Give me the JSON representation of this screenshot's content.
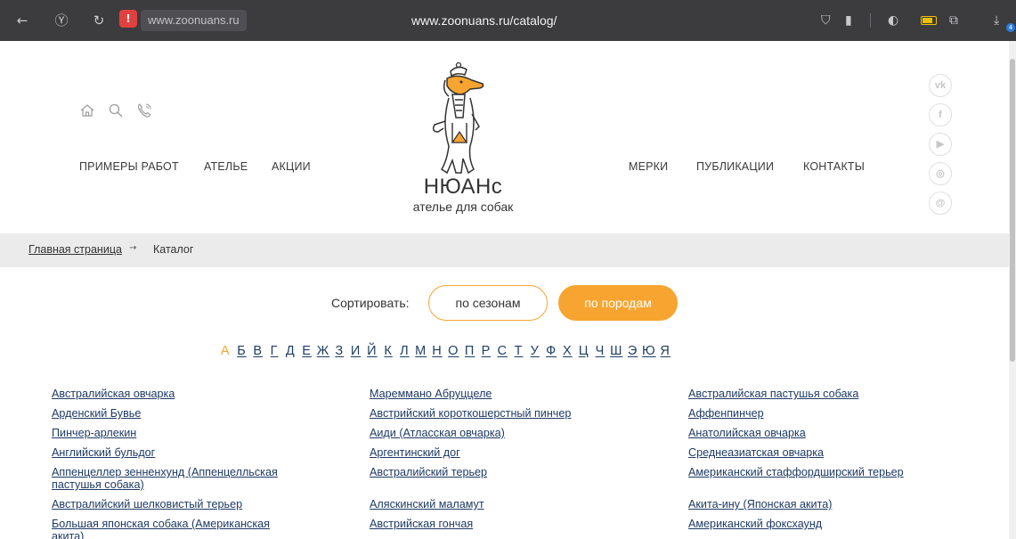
{
  "browser": {
    "site_chip": "www.zoonuans.ru",
    "url": "www.zoonuans.ru/catalog/",
    "badge": "!",
    "download_count": "4"
  },
  "nav": {
    "left": [
      "ПРИМЕРЫ РАБОТ",
      "АТЕЛЬЕ",
      "АКЦИИ"
    ],
    "right": [
      "МЕРКИ",
      "ПУБЛИКАЦИИ",
      "КОНТАКТЫ"
    ]
  },
  "logo": {
    "name": "НЮАНс",
    "subtitle": "ателье для собак"
  },
  "social": [
    "vk",
    "f",
    "▶",
    "◎",
    "@"
  ],
  "breadcrumb": {
    "home": "Главная страница",
    "arrow": "→",
    "current": "Каталог"
  },
  "sort": {
    "label": "Сортировать:",
    "by_season": "по сезонам",
    "by_breed": "по породам"
  },
  "alphabet": [
    "А",
    "Б",
    "В",
    "Г",
    "Д",
    "Е",
    "Ж",
    "З",
    "И",
    "Й",
    "К",
    "Л",
    "М",
    "Н",
    "О",
    "П",
    "Р",
    "С",
    "Т",
    "У",
    "Ф",
    "Х",
    "Ц",
    "Ч",
    "Ш",
    "Э",
    "Ю",
    "Я"
  ],
  "active_letter": "А",
  "breeds": {
    "col1": [
      "Австралийская овчарка",
      "Арденский Бувье",
      "Пинчер-арлекин",
      "Английский бульдог",
      "Аппенцеллер зенненхунд (Аппенцелльская",
      "пастушья собака)",
      "Австралийский шелковистый терьер",
      "Большая японская собака (Американская",
      "акита)"
    ],
    "col2": [
      "Мареммано Абруццеле",
      "Австрийский короткошерстный пинчер",
      "Аиди (Атласская овчарка)",
      "Аргентинский дог",
      "Австралийский терьер",
      "Аляскинский маламут",
      "Австрийская гончая"
    ],
    "col3": [
      "Австралийская пастушья собака",
      "Аффенпинчер",
      "Анатолийская овчарка",
      "Среднеазиатская овчарка",
      "Американский стаффордширский терьер",
      "Акита-ину (Японская акита)",
      "Американский фоксхаунд"
    ]
  },
  "colors": {
    "accent": "#f7a530",
    "link": "#1e3a64",
    "chrome": "#3c3c3f"
  }
}
